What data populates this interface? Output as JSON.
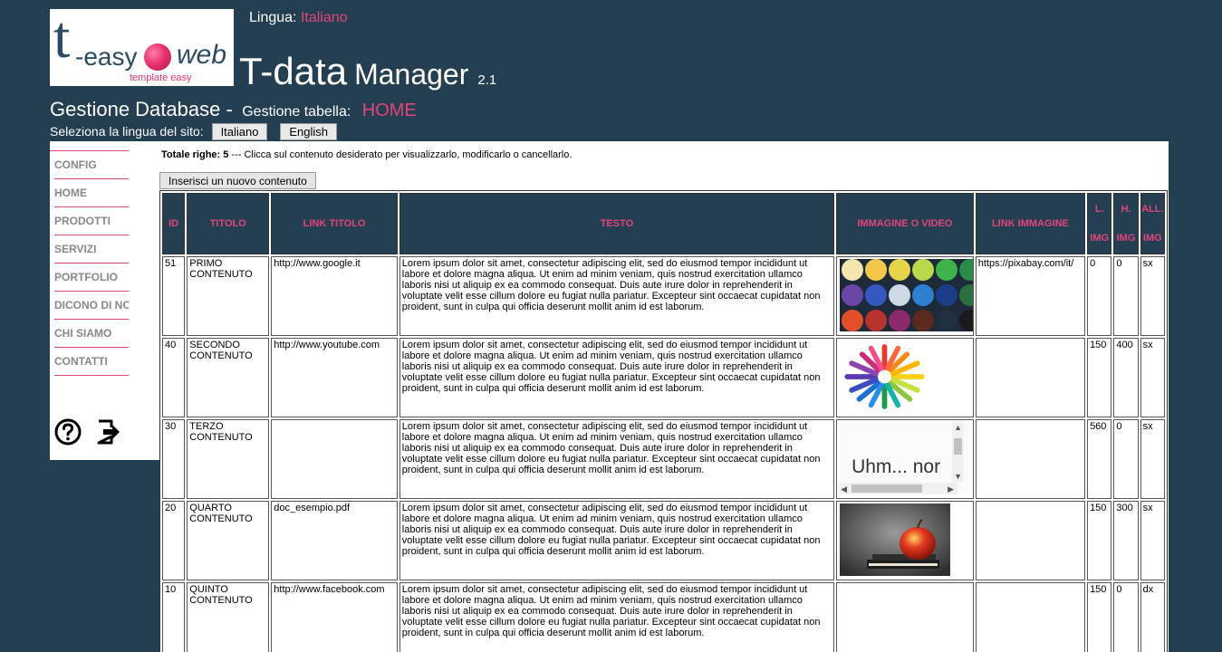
{
  "logo": {
    "t": "t",
    "easy": "-easy",
    "web": "web",
    "tag": "template easy"
  },
  "lingua": {
    "label": "Lingua:",
    "value": "Italiano"
  },
  "app": {
    "name": "T-data",
    "sub": "Manager",
    "version": "2.1"
  },
  "gestione": {
    "title": "Gestione Database -",
    "label": "Gestione tabella:",
    "table": "HOME"
  },
  "lang_select": {
    "label": "Seleziona la lingua del sito:",
    "it": "Italiano",
    "en": "English"
  },
  "sidebar": {
    "items": [
      "CONFIG",
      "HOME",
      "PRODOTTI",
      "SERVIZI",
      "PORTFOLIO",
      "DICONO DI NOI",
      "CHI SIAMO",
      "CONTATTI"
    ]
  },
  "icons": {
    "help": "question-circle-icon",
    "exit": "sign-out-icon"
  },
  "main": {
    "total_label": "Totale righe: 5",
    "total_rest": " --- Clicca sul contenuto desiderato per visualizzarlo, modificarlo o cancellarlo.",
    "new_button": "Inserisci un nuovo contenuto",
    "headers": [
      "ID",
      "TITOLO",
      "LINK TITOLO",
      "TESTO",
      "IMMAGINE O VIDEO",
      "LINK IMMAGINE"
    ],
    "headers_two": [
      [
        "L.",
        "IMG"
      ],
      [
        "H.",
        "IMG"
      ],
      [
        "ALL.",
        "IMG"
      ]
    ],
    "rows": [
      {
        "id": "51",
        "titolo": "PRIMO CONTENUTO",
        "link": "http://www.google.it",
        "testo": "Lorem ipsum dolor sit amet, consectetur adipiscing elit, sed do eiusmod tempor incididunt ut labore et dolore magna aliqua. Ut enim ad minim veniam, quis nostrud exercitation ullamco laboris nisi ut aliquip ex ea commodo consequat. Duis aute irure dolor in reprehenderit in voluptate velit esse cillum dolore eu fugiat nulla pariatur. Excepteur sint occaecat cupidatat non proident, sunt in culpa qui officia deserunt mollit anim id est laborum.",
        "media": "image-watercolor-paints",
        "link_img": "https://pixabay.com/it/",
        "l": "0",
        "h": "0",
        "all": "sx"
      },
      {
        "id": "40",
        "titolo": "SECONDO CONTENUTO",
        "link": "http://www.youtube.com",
        "testo": "Lorem ipsum dolor sit amet, consectetur adipiscing elit, sed do eiusmod tempor incididunt ut labore et dolore magna aliqua. Ut enim ad minim veniam, quis nostrud exercitation ullamco laboris nisi ut aliquip ex ea commodo consequat. Duis aute irure dolor in reprehenderit in voluptate velit esse cillum dolore eu fugiat nulla pariatur. Excepteur sint occaecat cupidatat non proident, sunt in culpa qui officia deserunt mollit anim id est laborum.",
        "media": "image-colored-pencils",
        "link_img": "",
        "l": "150",
        "h": "400",
        "all": "sx"
      },
      {
        "id": "30",
        "titolo": "TERZO CONTENUTO",
        "link": "",
        "testo": "Lorem ipsum dolor sit amet, consectetur adipiscing elit, sed do eiusmod tempor incididunt ut labore et dolore magna aliqua. Ut enim ad minim veniam, quis nostrud exercitation ullamco laboris nisi ut aliquip ex ea commodo consequat. Duis aute irure dolor in reprehenderit in voluptate velit esse cillum dolore eu fugiat nulla pariatur. Excepteur sint occaecat cupidatat non proident, sunt in culpa qui officia deserunt mollit anim id est laborum.",
        "media": "video-embed",
        "video_text": "Uhm... nor",
        "link_img": "",
        "l": "560",
        "h": "0",
        "all": "sx"
      },
      {
        "id": "20",
        "titolo": "QUARTO CONTENUTO",
        "link": "doc_esempio.pdf",
        "testo": "Lorem ipsum dolor sit amet, consectetur adipiscing elit, sed do eiusmod tempor incididunt ut labore et dolore magna aliqua. Ut enim ad minim veniam, quis nostrud exercitation ullamco laboris nisi ut aliquip ex ea commodo consequat. Duis aute irure dolor in reprehenderit in voluptate velit esse cillum dolore eu fugiat nulla pariatur. Excepteur sint occaecat cupidatat non proident, sunt in culpa qui officia deserunt mollit anim id est laborum.",
        "media": "image-apple-books",
        "link_img": "",
        "l": "150",
        "h": "300",
        "all": "sx"
      },
      {
        "id": "10",
        "titolo": "QUINTO CONTENUTO",
        "link": "http://www.facebook.com",
        "testo": "Lorem ipsum dolor sit amet, consectetur adipiscing elit, sed do eiusmod tempor incididunt ut labore et dolore magna aliqua. Ut enim ad minim veniam, quis nostrud exercitation ullamco laboris nisi ut aliquip ex ea commodo consequat. Duis aute irure dolor in reprehenderit in voluptate velit esse cillum dolore eu fugiat nulla pariatur. Excepteur sint occaecat cupidatat non proident, sunt in culpa qui officia deserunt mollit anim id est laborum.",
        "media": "",
        "link_img": "",
        "l": "150",
        "h": "0",
        "all": "dx"
      }
    ]
  },
  "colors": {
    "background": "#243e52",
    "accent": "#e2457a",
    "menu_text": "#888888"
  }
}
